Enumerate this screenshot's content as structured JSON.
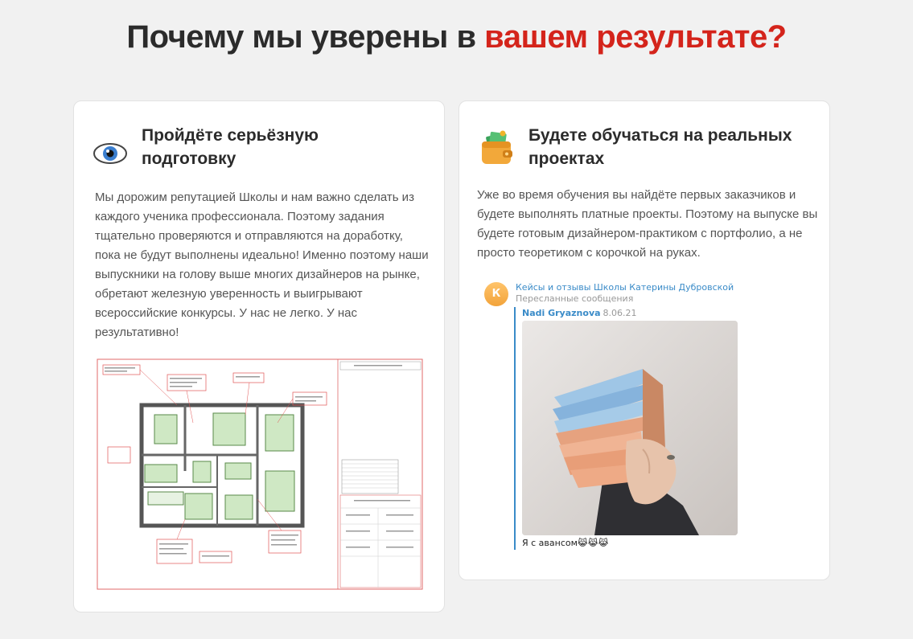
{
  "headline": {
    "text_before": "Почему мы уверены в ",
    "text_accent": "вашем результате?",
    "accent_color": "#d4241b"
  },
  "cards": [
    {
      "icon": "eye-icon",
      "title": "Пройдёте серьёзную подготовку",
      "title_line1": "Пройдёте серьёзную",
      "title_line2": "подготовку",
      "body_lines": [
        "Мы дорожим репутацией Школы и нам важно сделать из",
        "каждого ученика профессионала. Поэтому задания",
        "тщательно проверяются и отправляются на доработку,",
        "пока не будут выполнены идеально! Именно поэтому наши",
        "выпускники на голову выше многих дизайнеров на рынке,",
        "обретают железную уверенность и выигрывают",
        "всероссийские конкурсы. У нас не легко. У нас",
        "результативно!"
      ],
      "image": "floor-plan-drawing"
    },
    {
      "icon": "wallet-icon",
      "title": "Будете обучаться на реальных проектах",
      "title_line1": "Будете обучаться на реальных",
      "title_line2": "проектах",
      "body_lines": [
        "Уже во время обучения вы найдёте первых заказчиков и",
        "будете выполнять платные проекты. Поэтому на выпуске вы",
        "будете готовым дизайнером-практиком с портфолио, а не",
        "просто теоретиком с корочкой на руках."
      ],
      "telegram": {
        "avatar_letter": "К",
        "channel": "Кейсы и отзывы Школы Катерины Дубровской",
        "forwarded": "Пересланные сообщения",
        "author": "Nadi Gryaznova",
        "date": "8.06.21",
        "photo": "hand-holding-banknotes-photo",
        "caption": "Я с авансом😹😹😹"
      }
    }
  ]
}
